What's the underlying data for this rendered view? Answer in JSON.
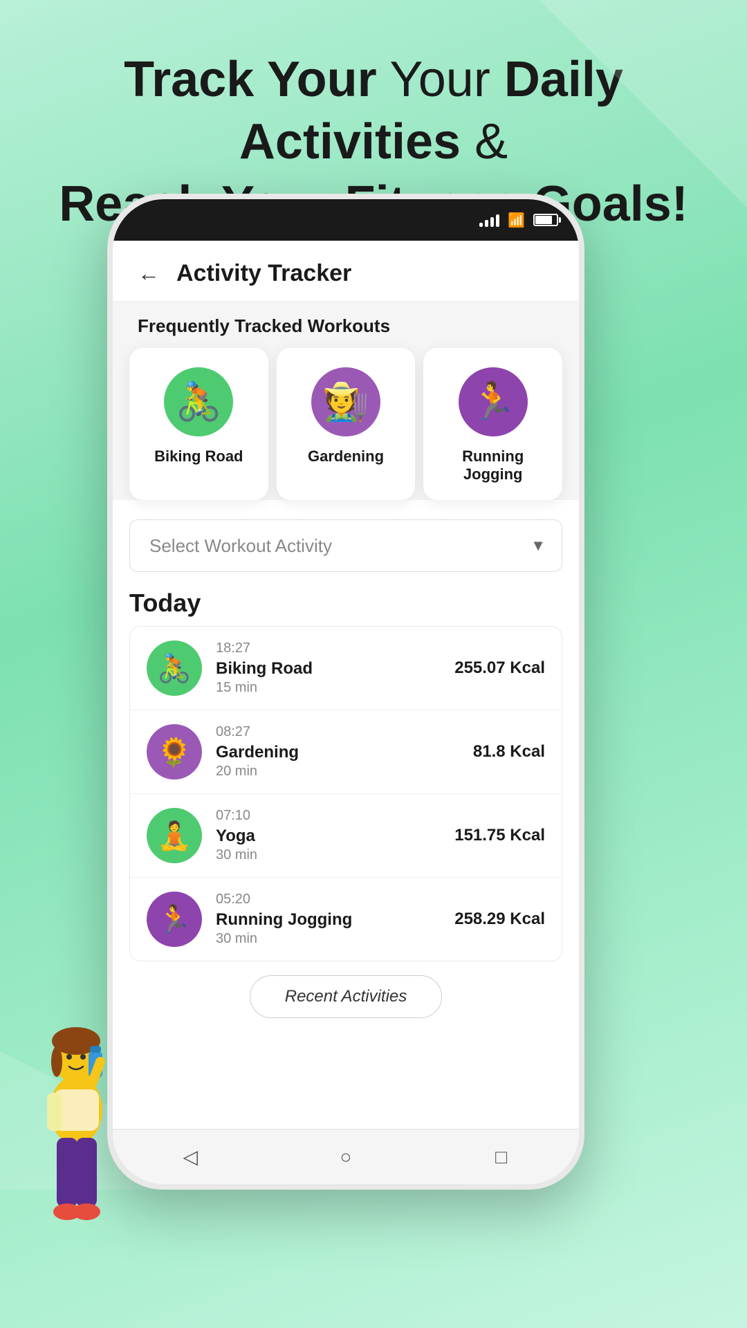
{
  "hero": {
    "line1_normal": "Track Your",
    "line1_bold": "Daily Activities",
    "line1_suffix": " &",
    "line2": "Reach Your Fitness Goals!"
  },
  "header": {
    "back_label": "←",
    "title": "Activity Tracker"
  },
  "frequently_tracked": {
    "section_title": "Frequently Tracked Workouts",
    "cards": [
      {
        "name": "Biking Road",
        "bg_color": "#4ecb71",
        "icon": "🚴"
      },
      {
        "name": "Gardening",
        "bg_color": "#9b59b6",
        "icon": "🧑‍🌾"
      },
      {
        "name": "Running Jogging",
        "bg_color": "#8e44ad",
        "icon": "🏃"
      }
    ]
  },
  "dropdown": {
    "placeholder": "Select Workout Activity",
    "arrow": "▼"
  },
  "today": {
    "label": "Today",
    "activities": [
      {
        "time": "18:27",
        "name": "Biking Road",
        "duration": "15 min",
        "calories": "255.07 Kcal",
        "bg_color": "#4ecb71",
        "icon": "🚴"
      },
      {
        "time": "08:27",
        "name": "Gardening",
        "duration": "20 min",
        "calories": "81.8 Kcal",
        "bg_color": "#9b59b6",
        "icon": "🌻"
      },
      {
        "time": "07:10",
        "name": "Yoga",
        "duration": "30 min",
        "calories": "151.75 Kcal",
        "bg_color": "#4ecb71",
        "icon": "🧘"
      },
      {
        "time": "05:20",
        "name": "Running Jogging",
        "duration": "30 min",
        "calories": "258.29 Kcal",
        "bg_color": "#8e44ad",
        "icon": "🏃"
      }
    ]
  },
  "recent_activities_btn": "Recent Activities",
  "nav": {
    "back": "◁",
    "home": "○",
    "square": "□"
  }
}
